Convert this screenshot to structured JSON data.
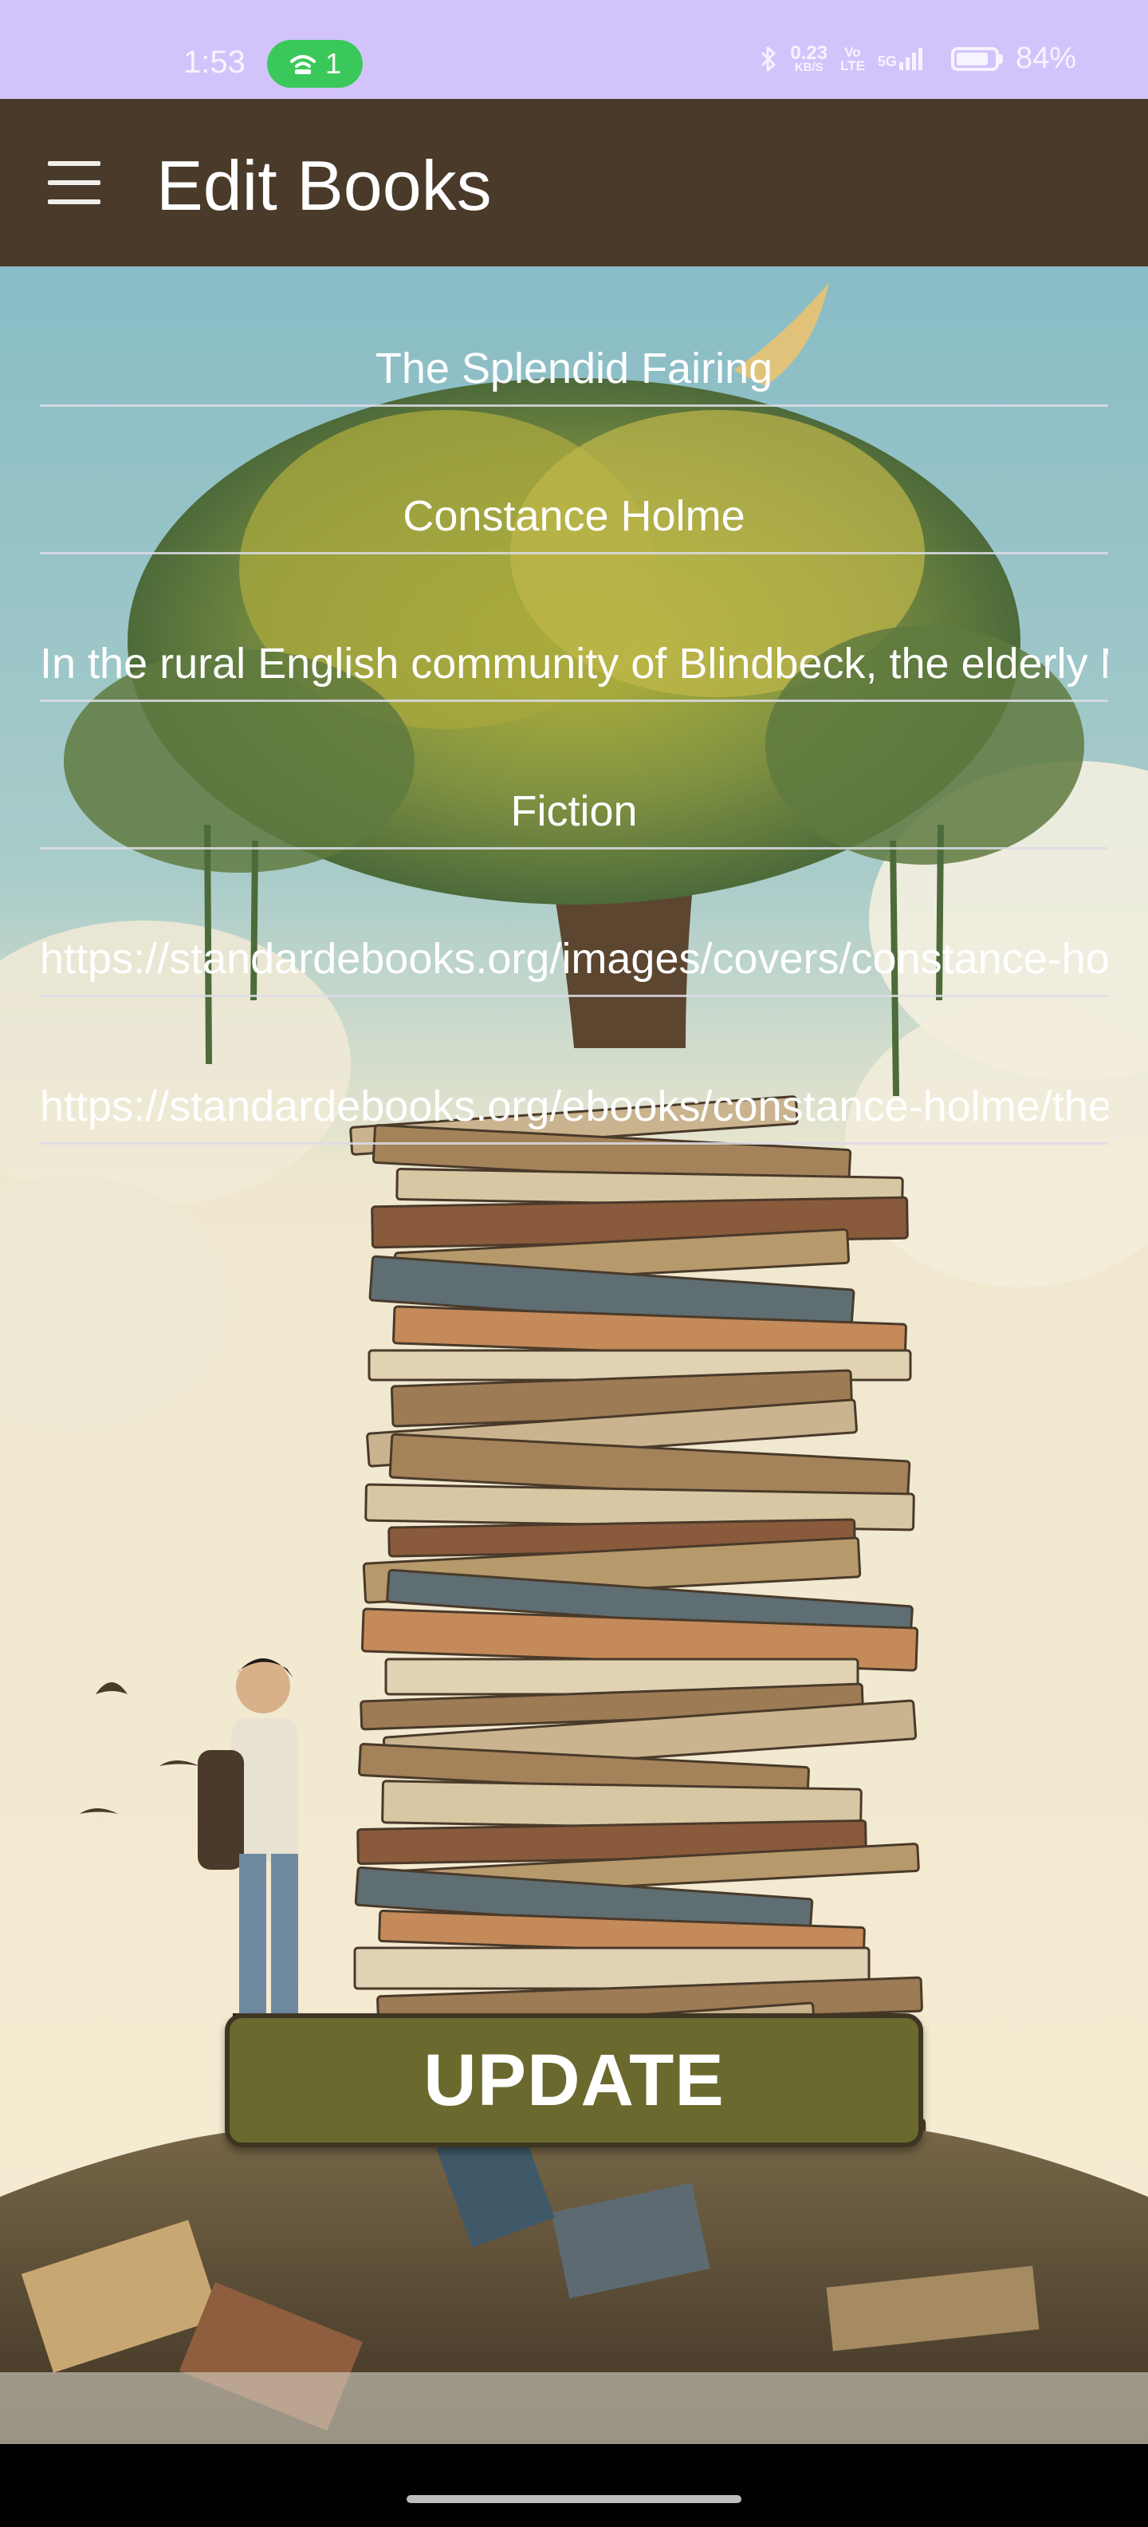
{
  "status_bar": {
    "time": "1:53",
    "hotspot_count": "1",
    "net_speed_value": "0.23",
    "net_speed_unit": "KB/S",
    "volte_top": "Vo",
    "volte_bottom": "LTE",
    "signal_label": "5G",
    "battery_percent": "84%",
    "battery_level": 0.84,
    "background_color": "#d2c4fb",
    "hotspot_color": "#3bc85a"
  },
  "app_bar": {
    "title": "Edit Books",
    "background_color": "#4a3a29",
    "menu_icon": "hamburger-menu-icon"
  },
  "form": {
    "title_value": "The Splendid Fairing",
    "author_value": "Constance Holme",
    "description_value": "In the rural English community of Blindbeck, the elderly Mrs. Gregson is preparing for the return of her son.",
    "genre_value": "Fiction",
    "cover_url_value": "https://standardebooks.org/images/covers/constance-holme_the-splendid-fairing.jpg",
    "ebook_url_value": "https://standardebooks.org/ebooks/constance-holme/the-splendid-fairing"
  },
  "actions": {
    "update_label": "UPDATE",
    "update_color": "#6b6a2e"
  }
}
